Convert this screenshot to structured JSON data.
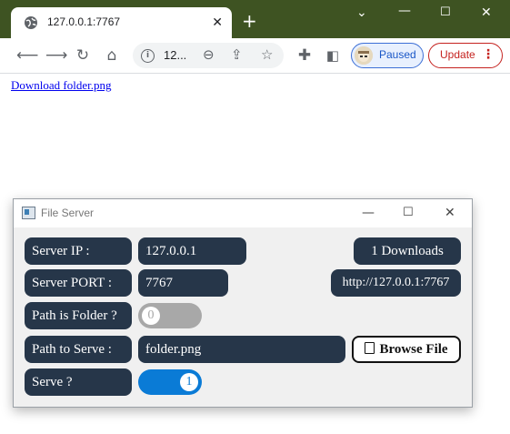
{
  "browser": {
    "tab_title": "127.0.0.1:7767",
    "omnibox_url": "12...",
    "profile_label": "Paused",
    "update_label": "Update"
  },
  "page": {
    "download_link": "Download folder.png"
  },
  "file_server": {
    "window_title": "File Server",
    "server_ip_label": "Server IP :",
    "server_ip_value": "127.0.0.1",
    "server_port_label": "Server PORT :",
    "server_port_value": "7767",
    "path_is_folder_label": "Path is Folder ?",
    "path_is_folder_value": "0",
    "path_to_serve_label": "Path to Serve :",
    "path_to_serve_value": "folder.png",
    "serve_label": "Serve ?",
    "serve_value": "1",
    "downloads_count": "1 Downloads",
    "server_url": "http://127.0.0.1:7767",
    "browse_label": "Browse File",
    "colors": {
      "pill_bg": "#263649",
      "toggle_off": "#a8a8a8",
      "toggle_on": "#0a7bd6"
    }
  }
}
